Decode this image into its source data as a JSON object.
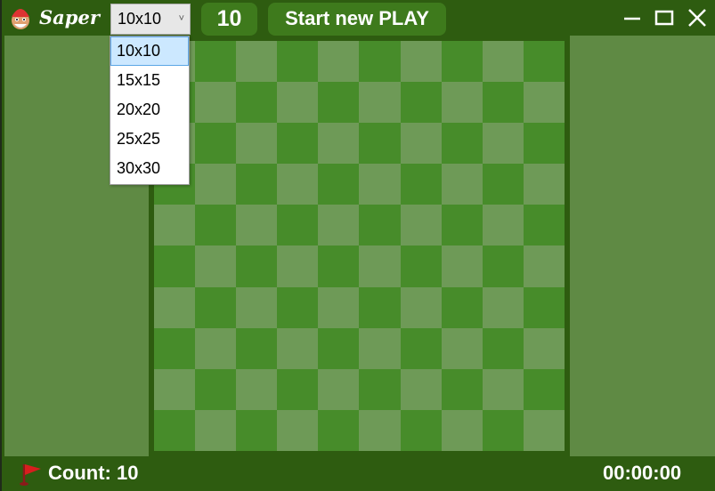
{
  "window": {
    "title": "Saper"
  },
  "toolbar": {
    "size_selected": "10x10",
    "mine_count": "10",
    "start_label": "Start new PLAY"
  },
  "dropdown": {
    "options": [
      "10x10",
      "15x15",
      "20x20",
      "25x25",
      "30x30"
    ]
  },
  "board": {
    "rows": 10,
    "cols": 10
  },
  "status": {
    "count_label": "Count: 10",
    "timer": "00:00:00"
  },
  "colors": {
    "frame": "#2e5c10",
    "side_panel": "#5f8a44",
    "cell_light": "#6e9a57",
    "cell_dark": "#478c2a",
    "button_bg": "#3e7a1c"
  },
  "icons": {
    "app": "gnome-icon",
    "flag": "flag-icon",
    "minimize": "minimize-icon",
    "maximize": "maximize-icon",
    "close": "close-icon",
    "dropdown": "chevron-down-icon"
  }
}
